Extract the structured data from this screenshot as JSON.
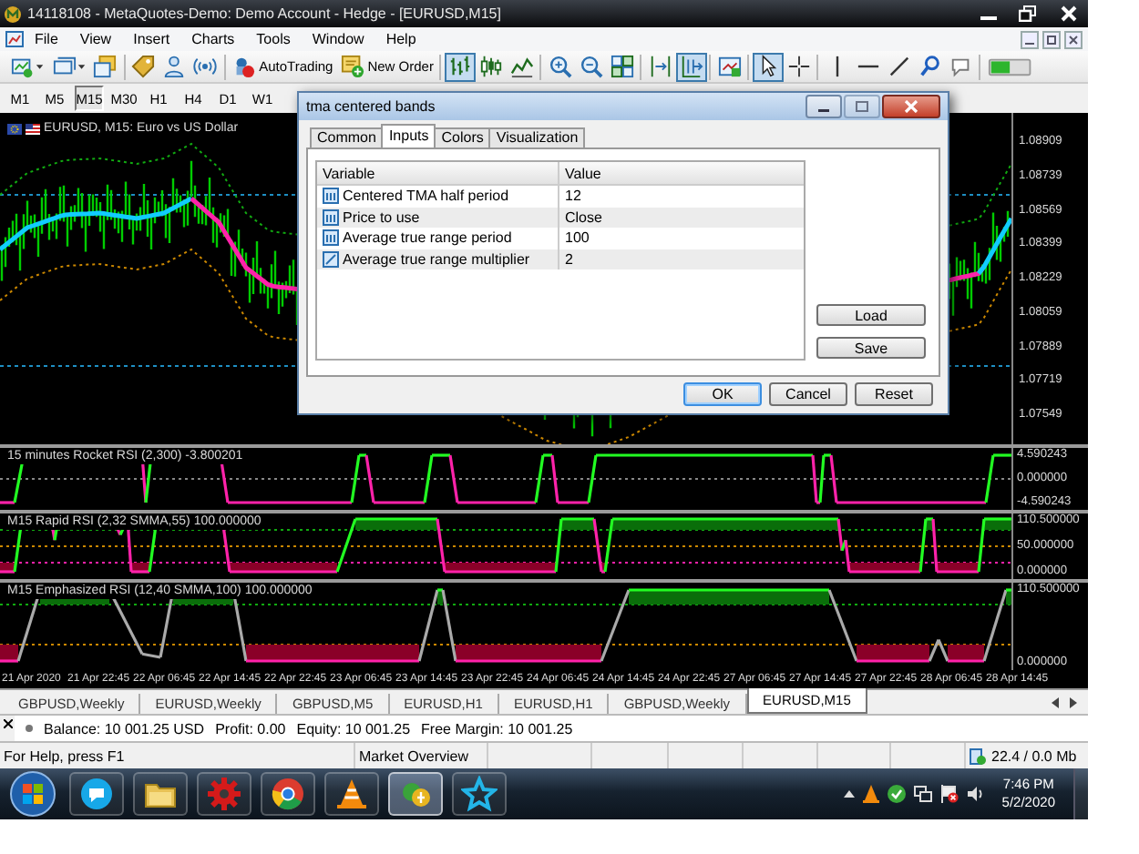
{
  "window": {
    "title": "14118108 - MetaQuotes-Demo: Demo Account - Hedge - [EURUSD,M15]"
  },
  "menu": [
    "File",
    "View",
    "Insert",
    "Charts",
    "Tools",
    "Window",
    "Help"
  ],
  "toolbar": [
    {
      "kind": "icon",
      "selected": false
    },
    {
      "kind": "icon",
      "selected": false
    },
    {
      "kind": "icon",
      "selected": false
    },
    {
      "kind": "separator"
    },
    {
      "kind": "icon",
      "selected": false
    },
    {
      "kind": "icon",
      "selected": false
    },
    {
      "kind": "icon",
      "selected": false
    },
    {
      "kind": "separator"
    },
    {
      "kind": "button",
      "label": "AutoTrading"
    },
    {
      "kind": "button",
      "label": "New Order"
    },
    {
      "kind": "separator"
    },
    {
      "kind": "icon",
      "selected": true
    },
    {
      "kind": "icon",
      "selected": false
    },
    {
      "kind": "icon",
      "selected": false
    },
    {
      "kind": "separator"
    },
    {
      "kind": "icon",
      "selected": false
    },
    {
      "kind": "icon",
      "selected": false
    },
    {
      "kind": "icon",
      "selected": false
    },
    {
      "kind": "separator"
    },
    {
      "kind": "icon",
      "selected": false
    },
    {
      "kind": "icon",
      "selected": true
    },
    {
      "kind": "separator"
    },
    {
      "kind": "icon",
      "selected": false
    },
    {
      "kind": "separator"
    },
    {
      "kind": "icon",
      "selected": true
    },
    {
      "kind": "icon",
      "selected": false
    },
    {
      "kind": "separator"
    },
    {
      "kind": "icon",
      "selected": false
    },
    {
      "kind": "icon",
      "selected": false
    },
    {
      "kind": "icon",
      "selected": false
    },
    {
      "kind": "icon",
      "selected": false
    },
    {
      "kind": "icon",
      "selected": false
    },
    {
      "kind": "separator"
    },
    {
      "kind": "icon",
      "selected": false
    }
  ],
  "timeframes": [
    {
      "label": "M1",
      "selected": false
    },
    {
      "label": "M5",
      "selected": false
    },
    {
      "label": "M15",
      "selected": true
    },
    {
      "label": "M30",
      "selected": false
    },
    {
      "label": "H1",
      "selected": false
    },
    {
      "label": "H4",
      "selected": false
    },
    {
      "label": "D1",
      "selected": false
    },
    {
      "label": "W1",
      "selected": false
    }
  ],
  "chart": {
    "title": "EURUSD, M15:  Euro vs US Dollar",
    "price_axis": [
      "1.08909",
      "1.08739",
      "1.08569",
      "1.08399",
      "1.08229",
      "1.08059",
      "1.07889",
      "1.07719",
      "1.07549"
    ],
    "indicators": [
      {
        "title": "15 minutes Rocket RSI (2,300) -3.800201",
        "axis": [
          "4.590243",
          "0.000000",
          "-4.590243"
        ]
      },
      {
        "title": "M15 Rapid RSI (2,32 SMMA,55) 100.000000",
        "axis": [
          "110.500000",
          "50.000000",
          "0.000000"
        ]
      },
      {
        "title": "M15 Emphasized RSI (12,40 SMMA,100) 100.000000",
        "axis": [
          "110.500000",
          "0.000000"
        ]
      }
    ],
    "time_axis": [
      "21 Apr 2020",
      "21 Apr 22:45",
      "22 Apr 06:45",
      "22 Apr 14:45",
      "22 Apr 22:45",
      "23 Apr 06:45",
      "23 Apr 14:45",
      "23 Apr 22:45",
      "24 Apr 06:45",
      "24 Apr 14:45",
      "24 Apr 22:45",
      "27 Apr 06:45",
      "27 Apr 14:45",
      "27 Apr 22:45",
      "28 Apr 06:45",
      "28 Apr 14:45"
    ]
  },
  "dialog": {
    "title": "tma centered bands",
    "tabs": [
      {
        "label": "Common",
        "selected": false
      },
      {
        "label": "Inputs",
        "selected": true
      },
      {
        "label": "Colors",
        "selected": false
      },
      {
        "label": "Visualization",
        "selected": false
      }
    ],
    "columns": [
      "Variable",
      "Value"
    ],
    "rows": [
      {
        "kind": "int",
        "variable": "Centered TMA half period",
        "value": "12"
      },
      {
        "kind": "int",
        "variable": "Price to use",
        "value": "Close"
      },
      {
        "kind": "int",
        "variable": "Average true range period",
        "value": "100"
      },
      {
        "kind": "double",
        "variable": "Average true range multiplier",
        "value": "2"
      }
    ],
    "side_buttons": [
      "Load",
      "Save"
    ],
    "buttons": [
      {
        "label": "OK",
        "focused": true
      },
      {
        "label": "Cancel",
        "focused": false
      },
      {
        "label": "Reset",
        "focused": false
      }
    ]
  },
  "chart_tabs": [
    {
      "label": "GBPUSD,Weekly",
      "selected": false
    },
    {
      "label": "EURUSD,Weekly",
      "selected": false
    },
    {
      "label": "GBPUSD,M5",
      "selected": false
    },
    {
      "label": "EURUSD,H1",
      "selected": false
    },
    {
      "label": "EURUSD,H1",
      "selected": false
    },
    {
      "label": "GBPUSD,Weekly",
      "selected": false
    },
    {
      "label": "EURUSD,M15",
      "selected": true
    }
  ],
  "trade_bar": [
    "Balance: 10 001.25 USD",
    "Profit: 0.00",
    "Equity: 10 001.25",
    "Free Margin: 10 001.25"
  ],
  "status_bar": {
    "help": "For Help, press F1",
    "panel": "Market Overview",
    "traffic": "22.4 / 0.0 Mb"
  },
  "taskbar": {
    "apps": [
      {
        "selected": false
      },
      {
        "selected": false
      },
      {
        "selected": false
      },
      {
        "selected": false
      },
      {
        "selected": false
      },
      {
        "selected": true
      },
      {
        "selected": false
      }
    ],
    "time": "7:46 PM",
    "date": "5/2/2020"
  }
}
